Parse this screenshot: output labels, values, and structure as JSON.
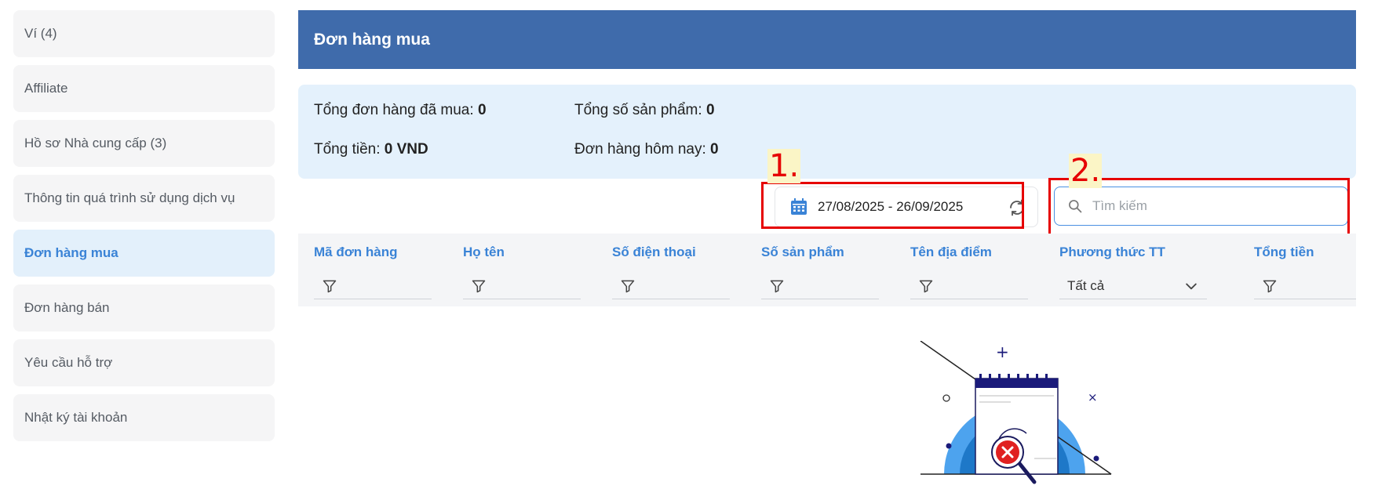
{
  "sidebar": {
    "items": [
      {
        "label": "Ví (4)"
      },
      {
        "label": "Affiliate"
      },
      {
        "label": "Hồ sơ Nhà cung cấp (3)"
      },
      {
        "label": "Thông tin quá trình sử dụng dịch vụ"
      },
      {
        "label": "Đơn hàng mua"
      },
      {
        "label": "Đơn hàng bán"
      },
      {
        "label": "Yêu cầu hỗ trợ"
      },
      {
        "label": "Nhật ký tài khoản"
      }
    ],
    "active_index": 4
  },
  "header": {
    "title": "Đơn hàng mua"
  },
  "stats": {
    "total_orders_label": "Tổng đơn hàng đã mua:",
    "total_orders_value": "0",
    "total_products_label": "Tổng số sản phẩm:",
    "total_products_value": "0",
    "total_money_label": "Tổng tiền:",
    "total_money_value": "0 VND",
    "today_orders_label": "Đơn hàng hôm nay:",
    "today_orders_value": "0"
  },
  "filters": {
    "date_range": "27/08/2025 - 26/09/2025",
    "search_placeholder": "Tìm kiếm"
  },
  "annotations": {
    "label_1": "1.",
    "label_2": "2."
  },
  "table": {
    "columns": [
      {
        "title": "Mã đơn hàng"
      },
      {
        "title": "Họ tên"
      },
      {
        "title": "Số điện thoại"
      },
      {
        "title": "Số sản phẩm"
      },
      {
        "title": "Tên địa điểm"
      },
      {
        "title": "Phương thức TT",
        "select_value": "Tất cả"
      },
      {
        "title": "Tổng tiền"
      }
    ]
  },
  "colors": {
    "header_bg": "#3f6bab",
    "accent": "#3a83d6",
    "annotation": "#e60000"
  },
  "icons": [
    "calendar-icon",
    "refresh-icon",
    "search-icon",
    "filter-icon",
    "chevron-down-icon",
    "empty-state-illustration"
  ]
}
